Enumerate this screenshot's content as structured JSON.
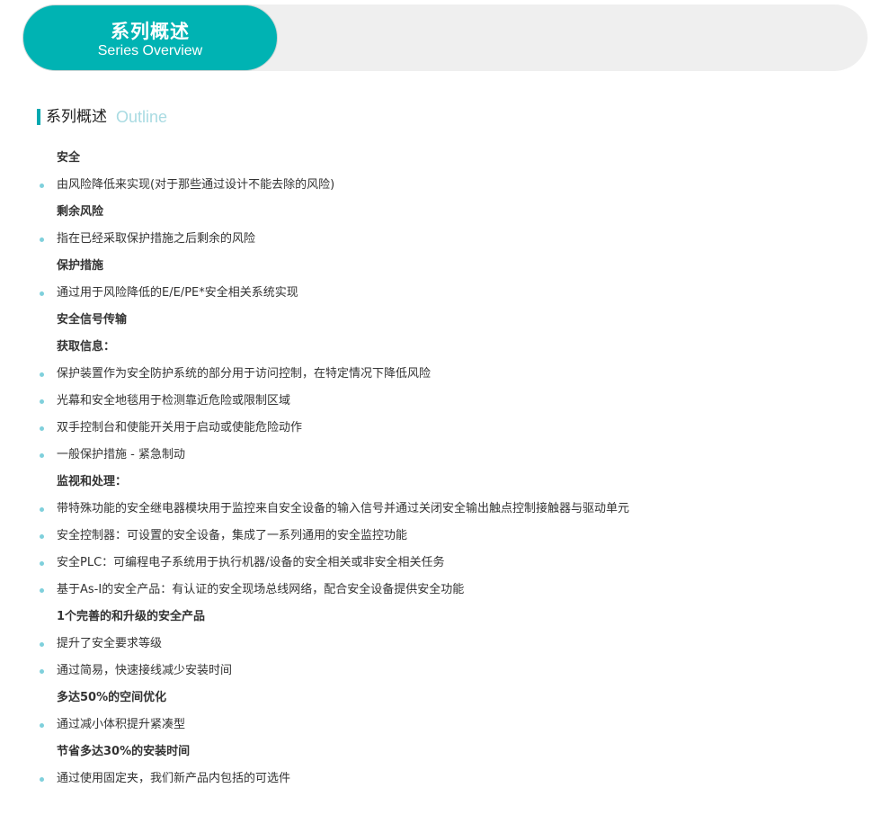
{
  "banner": {
    "title_cn": "系列概述",
    "title_en": "Series Overview"
  },
  "section": {
    "title_cn": "系列概述",
    "title_en": "Outline"
  },
  "items": [
    {
      "type": "heading",
      "text": "安全"
    },
    {
      "type": "bullet",
      "text": "由风险降低来实现(对于那些通过设计不能去除的风险)"
    },
    {
      "type": "heading",
      "text": "剩余风险"
    },
    {
      "type": "bullet",
      "text": "指在已经采取保护措施之后剩余的风险"
    },
    {
      "type": "heading",
      "text": "保护措施"
    },
    {
      "type": "bullet",
      "text": "通过用于风险降低的E/E/PE*安全相关系统实现"
    },
    {
      "type": "heading",
      "text": "安全信号传输"
    },
    {
      "type": "heading",
      "text": "获取信息："
    },
    {
      "type": "bullet",
      "text": "保护装置作为安全防护系统的部分用于访问控制，在特定情况下降低风险"
    },
    {
      "type": "bullet",
      "text": "光幕和安全地毯用于检测靠近危险或限制区域"
    },
    {
      "type": "bullet",
      "text": "双手控制台和使能开关用于启动或使能危险动作"
    },
    {
      "type": "bullet",
      "text": "一般保护措施 - 紧急制动"
    },
    {
      "type": "heading",
      "text": "监视和处理："
    },
    {
      "type": "bullet",
      "text": "带特殊功能的安全继电器模块用于监控来自安全设备的输入信号并通过关闭安全输出触点控制接触器与驱动单元"
    },
    {
      "type": "bullet",
      "text": "安全控制器：可设置的安全设备，集成了一系列通用的安全监控功能"
    },
    {
      "type": "bullet",
      "text": "安全PLC：可编程电子系统用于执行机器/设备的安全相关或非安全相关任务"
    },
    {
      "type": "bullet",
      "text": "基于As-I的安全产品：有认证的安全现场总线网络，配合安全设备提供安全功能"
    },
    {
      "type": "heading",
      "text": "1个完善的和升级的安全产品"
    },
    {
      "type": "bullet",
      "text": "提升了安全要求等级"
    },
    {
      "type": "bullet",
      "text": "通过简易，快速接线减少安装时间"
    },
    {
      "type": "heading",
      "text": "多达50%的空间优化"
    },
    {
      "type": "bullet",
      "text": "通过减小体积提升紧凑型"
    },
    {
      "type": "heading",
      "text": "节省多达30%的安装时间"
    },
    {
      "type": "bullet",
      "text": "通过使用固定夹，我们新产品内包括的可选件"
    }
  ]
}
